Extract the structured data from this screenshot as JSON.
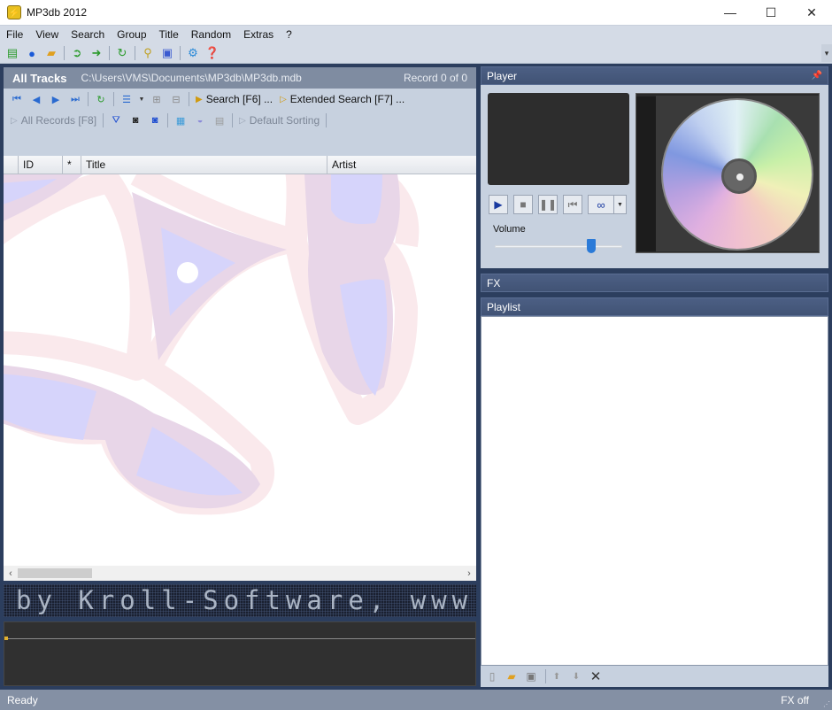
{
  "window": {
    "title": "MP3db 2012",
    "minimize_glyph": "—",
    "maximize_glyph": "☐",
    "close_glyph": "✕"
  },
  "menu": {
    "items": [
      {
        "label": "File",
        "accel": "F"
      },
      {
        "label": "View",
        "accel": "V"
      },
      {
        "label": "Search",
        "accel": "S"
      },
      {
        "label": "Group",
        "accel": "G"
      },
      {
        "label": "Title",
        "accel": "T"
      },
      {
        "label": "Random",
        "accel": "R"
      },
      {
        "label": "Extras",
        "accel": "E"
      },
      {
        "label": "?",
        "accel": ""
      }
    ]
  },
  "toolbar": {
    "icons": [
      "new-record-icon",
      "play-disc-icon",
      "open-folder-icon",
      "import-icon",
      "export-icon",
      "refresh-icon",
      "search-tag-icon",
      "cd-cover-icon",
      "settings-icon",
      "help-icon"
    ],
    "overflow_glyph": "▾"
  },
  "tracks": {
    "title": "All Tracks",
    "path": "C:\\Users\\VMS\\Documents\\MP3db\\MP3db.mdb",
    "record": "Record 0 of 0",
    "search_label": "Search [F6] ...",
    "extended_search_label": "Extended Search [F7] ...",
    "all_records_label": "All Records [F8]",
    "sorting_label": "Default Sorting",
    "filter_value": "",
    "columns": [
      "",
      "ID",
      "*",
      "Title",
      "Artist"
    ],
    "rows": []
  },
  "ticker": {
    "text": "by Kroll-Software, www."
  },
  "player": {
    "header": "Player",
    "volume_label": "Volume",
    "volume_level": 0.76,
    "loop_glyph": "∞"
  },
  "fx": {
    "header": "FX"
  },
  "playlist": {
    "header": "Playlist",
    "items": []
  },
  "status": {
    "left": "Ready",
    "right": "FX off"
  }
}
